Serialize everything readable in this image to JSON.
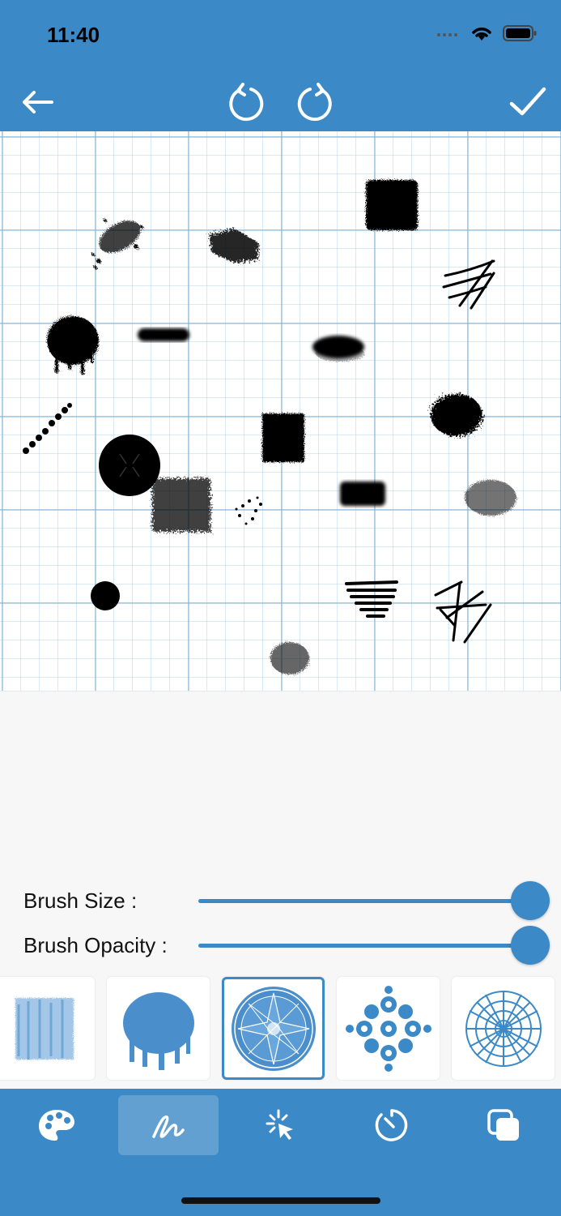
{
  "status_bar": {
    "time": "11:40"
  },
  "toolbar": {
    "back_icon": "arrow-left-icon",
    "undo_icon": "undo-icon",
    "redo_icon": "redo-icon",
    "done_icon": "checkmark-icon"
  },
  "controls": {
    "brush_size_label": "Brush Size :",
    "brush_size_value": 1.0,
    "brush_opacity_label": "Brush Opacity :",
    "brush_opacity_value": 1.0
  },
  "brushes": {
    "items": [
      "crayon-brush",
      "splatter-drip-brush",
      "mandala-star-brush",
      "mandala-flower-brush",
      "mandala-lace-brush"
    ],
    "selected_index": 2
  },
  "tab_bar": {
    "items": [
      "palette-icon",
      "brush-stroke-icon",
      "magic-select-icon",
      "timer-icon",
      "layers-icon"
    ],
    "active_index": 1
  },
  "colors": {
    "accent": "#3b89c6",
    "background": "#f7f7f7",
    "canvas": "#ffffff",
    "ink": "#000000"
  }
}
